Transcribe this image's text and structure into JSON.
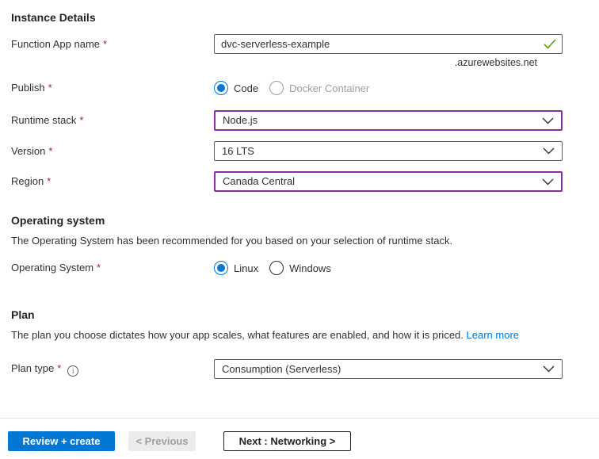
{
  "colors": {
    "accent": "#0078D4",
    "modified_field_border": "#8A2DA5",
    "valid_check": "#57A300",
    "required_marker": "#A4262C",
    "disabled_text": "#A19F9D"
  },
  "required_marker": "*",
  "instance_details": {
    "title": "Instance Details",
    "function_app_name": {
      "label": "Function App name",
      "value": "dvc-serverless-example",
      "suffix": ".azurewebsites.net"
    },
    "publish": {
      "label": "Publish",
      "options": [
        {
          "label": "Code",
          "selected": true
        },
        {
          "label": "Docker Container",
          "disabled": true
        }
      ]
    },
    "runtime_stack": {
      "label": "Runtime stack",
      "value": "Node.js"
    },
    "version": {
      "label": "Version",
      "value": "16 LTS"
    },
    "region": {
      "label": "Region",
      "value": "Canada Central"
    }
  },
  "operating_system": {
    "title": "Operating system",
    "description": "The Operating System has been recommended for you based on your selection of runtime stack.",
    "field": {
      "label": "Operating System",
      "options": [
        {
          "label": "Linux",
          "selected": true
        },
        {
          "label": "Windows"
        }
      ]
    }
  },
  "plan": {
    "title": "Plan",
    "description": "The plan you choose dictates how your app scales, what features are enabled, and how it is priced.",
    "learn_more_label": "Learn more",
    "plan_type": {
      "label": "Plan type",
      "value": "Consumption (Serverless)"
    }
  },
  "footer": {
    "review_create_label": "Review + create",
    "previous_label": "< Previous",
    "next_label": "Next : Networking >"
  }
}
